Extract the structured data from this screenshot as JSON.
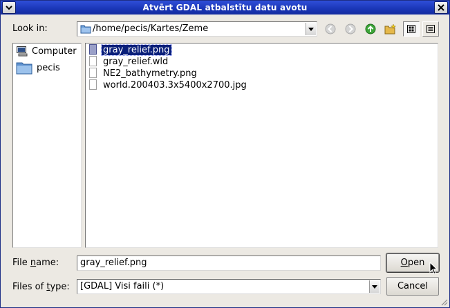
{
  "window": {
    "title": "Atvērt GDAL atbalstītu datu avotu"
  },
  "toolbar": {
    "look_in_label": "Look in:",
    "path": "/home/pecis/Kartes/Zeme",
    "buttons": [
      "back-icon",
      "forward-icon",
      "parent-directory-icon",
      "new-folder-icon",
      "list-view-icon",
      "detail-view-icon"
    ]
  },
  "sidebar": {
    "items": [
      {
        "label": "Computer",
        "icon": "computer-icon"
      },
      {
        "label": "pecis",
        "icon": "folder-icon"
      }
    ]
  },
  "files": {
    "items": [
      {
        "name": "gray_relief.png",
        "selected": true
      },
      {
        "name": "gray_relief.wld",
        "selected": false
      },
      {
        "name": "NE2_bathymetry.png",
        "selected": false
      },
      {
        "name": "world.200403.3x5400x2700.jpg",
        "selected": false
      }
    ]
  },
  "footer": {
    "file_name_label_pre": "File ",
    "file_name_label_u": "n",
    "file_name_label_post": "ame:",
    "file_name_value": "gray_relief.png",
    "files_of_type_label_pre": "Files of ",
    "files_of_type_label_u": "t",
    "files_of_type_label_post": "ype:",
    "files_of_type_value": "[GDAL] Visi faili (*)",
    "open_label_u": "O",
    "open_label_rest": "pen",
    "cancel_label": "Cancel"
  },
  "colors": {
    "titlebar": "#1a36b6",
    "selection": "#0a1f7a",
    "dialog_bg": "#ece9e3"
  }
}
